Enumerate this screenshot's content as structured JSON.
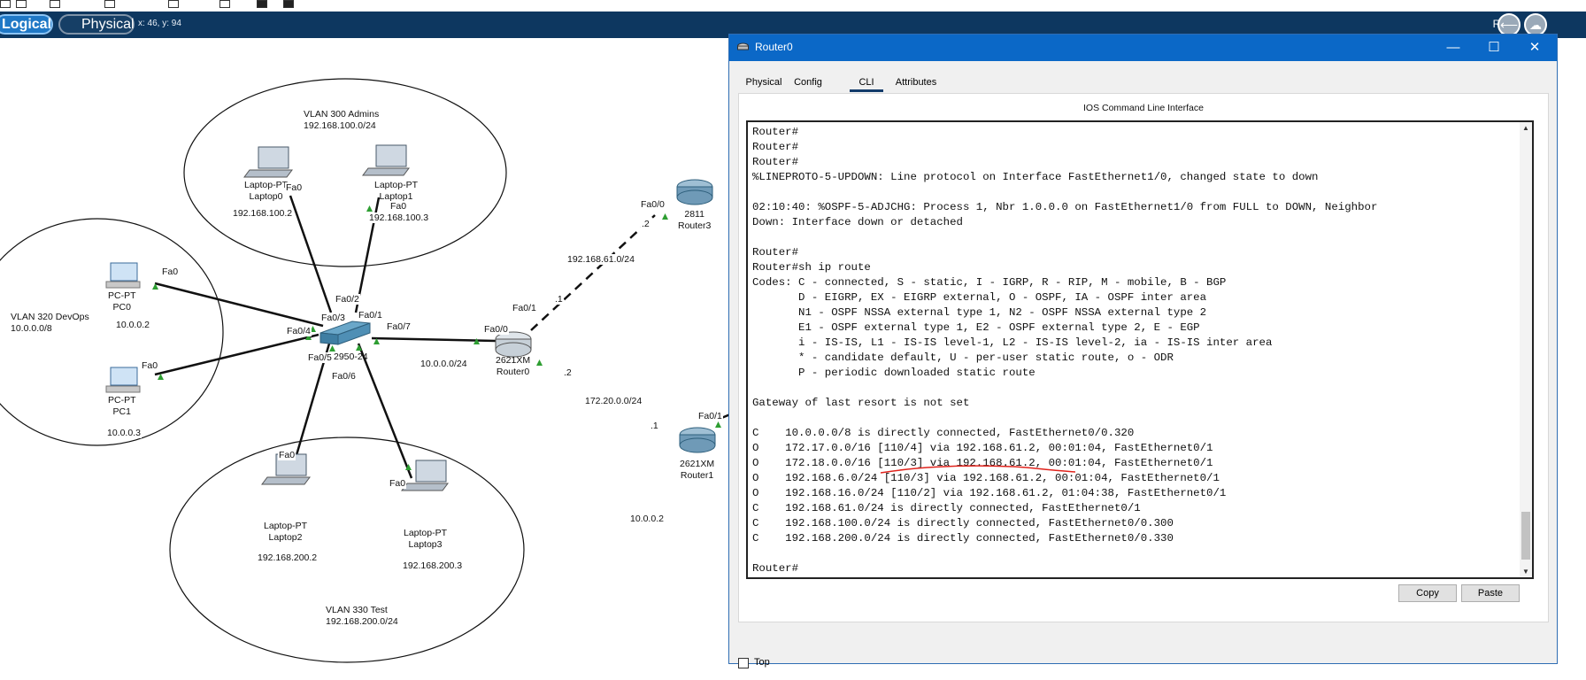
{
  "toolbar": {
    "logical_label": "Logical",
    "physical_label": "Physical",
    "coords": "x: 46, y: 94",
    "root_label": "Root",
    "icons": [
      "select-icon",
      "zoom-icon",
      "note-icon",
      "delete-icon",
      "resize-icon",
      "draw-icon",
      "add-simple-pdu-icon",
      "add-complex-pdu-icon",
      "back-icon",
      "cloud-icon"
    ]
  },
  "topology": {
    "areas": [
      {
        "name": "VLAN 300 Admins",
        "subnet": "192.168.100.0/24"
      },
      {
        "name": "VLAN 320 DevOps",
        "subnet": "10.0.0.0/8"
      },
      {
        "name": "VLAN 330 Test",
        "subnet": "192.168.200.0/24"
      }
    ],
    "devices": {
      "pc0": {
        "type": "PC-PT",
        "name": "PC0",
        "ip": "10.0.0.2",
        "port": "Fa0"
      },
      "pc1": {
        "type": "PC-PT",
        "name": "PC1",
        "ip": "10.0.0.3",
        "port": "Fa0"
      },
      "laptop0": {
        "type": "Laptop-PT",
        "name": "Laptop0",
        "ip": "192.168.100.2",
        "port": "Fa0"
      },
      "laptop1": {
        "type": "Laptop-PT",
        "name": "Laptop1",
        "ip": "192.168.100.3",
        "port": "Fa0"
      },
      "laptop2": {
        "type": "Laptop-PT",
        "name": "Laptop2",
        "ip": "192.168.200.2",
        "port": "Fa0"
      },
      "laptop3": {
        "type": "Laptop-PT",
        "name": "Laptop3",
        "ip": "192.168.200.3",
        "port": "Fa0"
      },
      "switch": {
        "model": "2950-24",
        "ports": [
          "Fa0/1",
          "Fa0/2",
          "Fa0/3",
          "Fa0/4",
          "Fa0/5",
          "Fa0/6",
          "Fa0/7"
        ]
      },
      "router0": {
        "model": "2621XM",
        "name": "Router0",
        "ports": [
          "Fa0/0",
          "Fa0/1"
        ]
      },
      "router1": {
        "model": "2621XM",
        "name": "Router1",
        "ports": [
          "Fa0/1"
        ]
      },
      "router3": {
        "model": "2811",
        "name": "Router3",
        "ports": [
          "Fa0/0"
        ]
      }
    },
    "link_labels": [
      "10.0.0.0/24",
      "192.168.61.0/24",
      "172.20.0.0/24",
      "10.0.0.2"
    ],
    "host_octets": [
      ".2",
      ".1",
      ".2",
      ".1"
    ]
  },
  "window": {
    "title": "Router0",
    "tabs": [
      "Physical",
      "Config",
      "CLI",
      "Attributes"
    ],
    "active_tab": "CLI",
    "panel_title": "IOS Command Line Interface",
    "terminal_lines": [
      "Router#",
      "Router#",
      "Router#",
      "%LINEPROTO-5-UPDOWN: Line protocol on Interface FastEthernet1/0, changed state to down",
      "",
      "02:10:40: %OSPF-5-ADJCHG: Process 1, Nbr 1.0.0.0 on FastEthernet1/0 from FULL to DOWN, Neighbor",
      "Down: Interface down or detached",
      "",
      "Router#",
      "Router#sh ip route",
      "Codes: C - connected, S - static, I - IGRP, R - RIP, M - mobile, B - BGP",
      "       D - EIGRP, EX - EIGRP external, O - OSPF, IA - OSPF inter area",
      "       N1 - OSPF NSSA external type 1, N2 - OSPF NSSA external type 2",
      "       E1 - OSPF external type 1, E2 - OSPF external type 2, E - EGP",
      "       i - IS-IS, L1 - IS-IS level-1, L2 - IS-IS level-2, ia - IS-IS inter area",
      "       * - candidate default, U - per-user static route, o - ODR",
      "       P - periodic downloaded static route",
      "",
      "Gateway of last resort is not set",
      "",
      "C    10.0.0.0/8 is directly connected, FastEthernet0/0.320",
      "O    172.17.0.0/16 [110/4] via 192.168.61.2, 00:01:04, FastEthernet0/1",
      "O    172.18.0.0/16 [110/3] via 192.168.61.2, 00:01:04, FastEthernet0/1",
      "O    192.168.6.0/24 [110/3] via 192.168.61.2, 00:01:04, FastEthernet0/1",
      "O    192.168.16.0/24 [110/2] via 192.168.61.2, 01:04:38, FastEthernet0/1",
      "C    192.168.61.0/24 is directly connected, FastEthernet0/1",
      "C    192.168.100.0/24 is directly connected, FastEthernet0/0.300",
      "C    192.168.200.0/24 is directly connected, FastEthernet0/0.330",
      "",
      "Router#"
    ],
    "copy_label": "Copy",
    "paste_label": "Paste",
    "top_label": "Top"
  }
}
